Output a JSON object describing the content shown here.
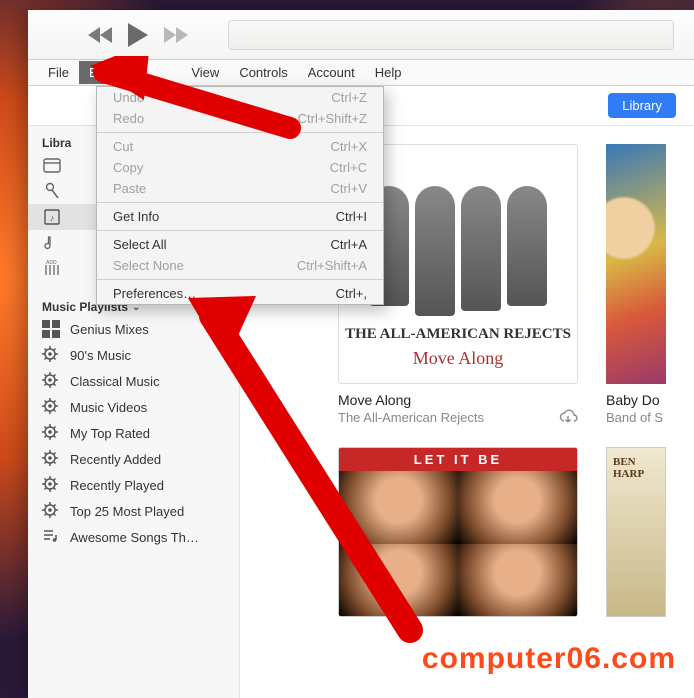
{
  "menubar": {
    "items": [
      "File",
      "Edit",
      "View",
      "Controls",
      "Account",
      "Help"
    ],
    "active_index": 1
  },
  "toolbar": {
    "library_button": "Library"
  },
  "sidebar": {
    "library_header": "Libra",
    "playlists_header": "Music Playlists",
    "playlists": [
      "Genius Mixes",
      "90's Music",
      "Classical Music",
      "Music Videos",
      "My Top Rated",
      "Recently Added",
      "Recently Played",
      "Top 25 Most Played",
      "Awesome Songs Th…"
    ]
  },
  "dropdown": {
    "groups": [
      [
        {
          "label": "Undo",
          "shortcut": "Ctrl+Z",
          "disabled": true
        },
        {
          "label": "Redo",
          "shortcut": "Ctrl+Shift+Z",
          "disabled": true
        }
      ],
      [
        {
          "label": "Cut",
          "shortcut": "Ctrl+X",
          "disabled": true
        },
        {
          "label": "Copy",
          "shortcut": "Ctrl+C",
          "disabled": true
        },
        {
          "label": "Paste",
          "shortcut": "Ctrl+V",
          "disabled": true
        }
      ],
      [
        {
          "label": "Get Info",
          "shortcut": "Ctrl+I",
          "disabled": false
        }
      ],
      [
        {
          "label": "Select All",
          "shortcut": "Ctrl+A",
          "disabled": false
        },
        {
          "label": "Select None",
          "shortcut": "Ctrl+Shift+A",
          "disabled": true
        }
      ],
      [
        {
          "label": "Preferences…",
          "shortcut": "Ctrl+,",
          "disabled": false
        }
      ]
    ]
  },
  "albums": {
    "a1": {
      "cover_text1": "THE ALL-AMERICAN REJECTS",
      "cover_text2": "Move Along",
      "title": "Move Along",
      "artist": "The All-American Rejects"
    },
    "a2": {
      "title": "Baby Do",
      "artist": "Band of S"
    },
    "a3": {
      "banner": "LET IT BE"
    }
  },
  "watermark": "computer06.com"
}
